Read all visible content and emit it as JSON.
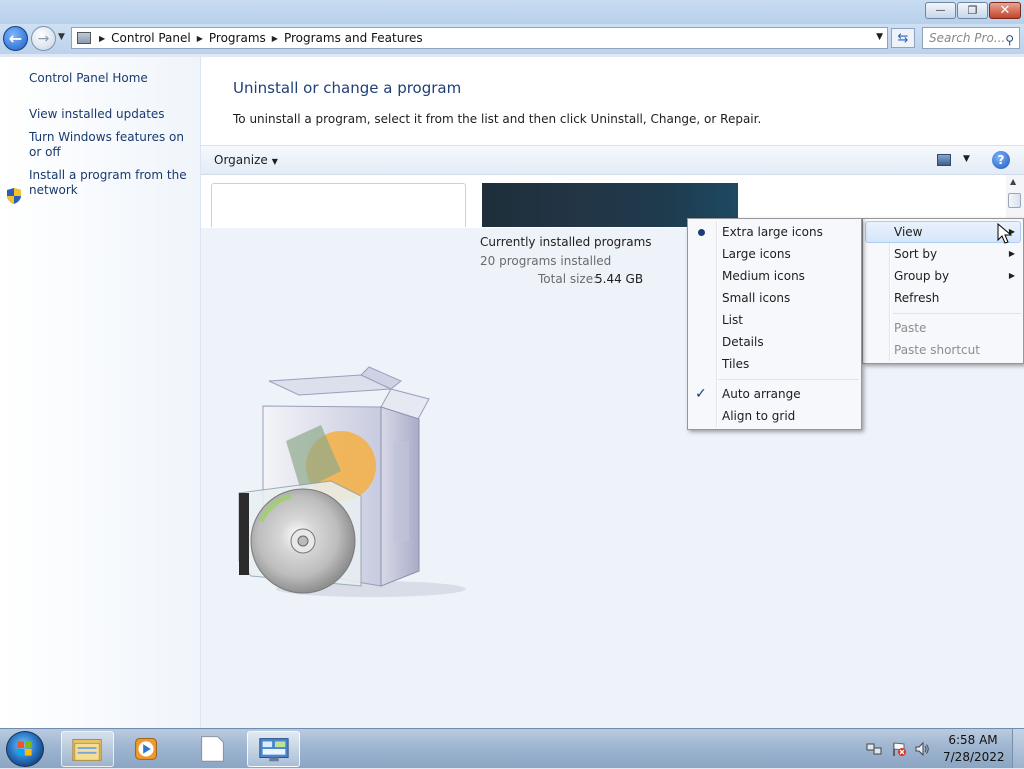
{
  "window": {
    "close_glyph": "✕",
    "min_glyph": "—",
    "max_glyph": "❐"
  },
  "address_bar": {
    "crumbs": [
      "Control Panel",
      "Programs",
      "Programs and Features"
    ],
    "search_placeholder": "Search Pro..."
  },
  "left_nav": {
    "home": "Control Panel Home",
    "links": [
      "View installed updates",
      "Turn Windows features on or off",
      "Install a program from the network"
    ]
  },
  "main": {
    "title": "Uninstall or change a program",
    "description": "To uninstall a program, select it from the list and then click Uninstall, Change, or Repair.",
    "organize_label": "Organize",
    "help_glyph": "?",
    "summary": {
      "title": "Currently installed programs",
      "count": "20 programs installed",
      "size_label": "Total size:",
      "size_value": "5.44 GB"
    }
  },
  "context_menu": {
    "items": [
      {
        "label": "View",
        "submenu": true,
        "highlighted": true
      },
      {
        "label": "Sort by",
        "submenu": true
      },
      {
        "label": "Group by",
        "submenu": true
      },
      {
        "label": "Refresh"
      },
      {
        "label": "Paste",
        "disabled": true
      },
      {
        "label": "Paste shortcut",
        "disabled": true
      }
    ]
  },
  "view_submenu": {
    "items": [
      {
        "label": "Extra large icons",
        "selected": true
      },
      {
        "label": "Large icons"
      },
      {
        "label": "Medium icons"
      },
      {
        "label": "Small icons"
      },
      {
        "label": "List"
      },
      {
        "label": "Details"
      },
      {
        "label": "Tiles"
      },
      {
        "label": "Auto arrange",
        "checked": true
      },
      {
        "label": "Align to grid"
      }
    ]
  },
  "taskbar": {
    "clock_time": "6:58 AM",
    "clock_date": "7/28/2022"
  },
  "colors": {
    "link": "#1a3a6e",
    "title": "#1f3f7a",
    "accent": "#1a56b6"
  }
}
